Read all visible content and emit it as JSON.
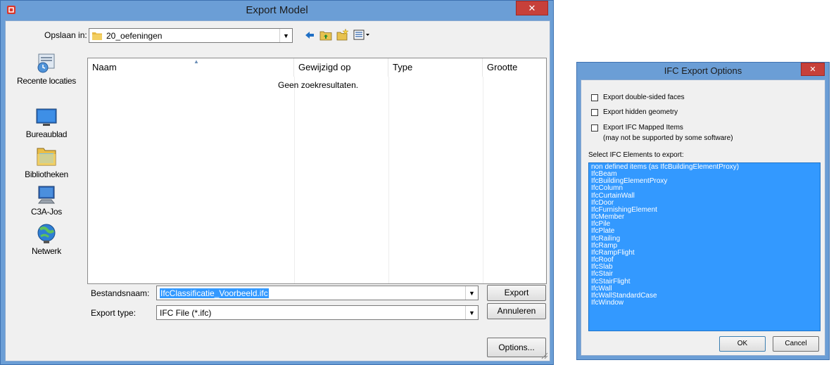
{
  "export_dialog": {
    "title": "Export Model",
    "save_in_label": "Opslaan in:",
    "save_in_value": "20_oefeningen",
    "places": [
      {
        "label": "Recente locaties",
        "icon": "recent-places-icon"
      },
      {
        "label": "Bureaublad",
        "icon": "desktop-icon"
      },
      {
        "label": "Bibliotheken",
        "icon": "libraries-icon"
      },
      {
        "label": "C3A-Jos",
        "icon": "computer-icon"
      },
      {
        "label": "Netwerk",
        "icon": "network-icon"
      }
    ],
    "columns": [
      "Naam",
      "Gewijzigd op",
      "Type",
      "Grootte"
    ],
    "empty_text": "Geen zoekresultaten.",
    "filename_label": "Bestandsnaam:",
    "filename_value": "IfcClassificatie_Voorbeeld.ifc",
    "export_type_label": "Export type:",
    "export_type_value": "IFC File (*.ifc)",
    "export_button": "Export",
    "cancel_button": "Annuleren",
    "options_button": "Options..."
  },
  "ifc_dialog": {
    "title": "IFC Export Options",
    "checkbox_double_sided": "Export double-sided faces",
    "checkbox_hidden": "Export hidden geometry",
    "checkbox_mapped": "Export IFC Mapped Items",
    "checkbox_mapped_note": "(may not be supported by some software)",
    "elements_label": "Select IFC Elements to export:",
    "elements": [
      "non defined items (as IfcBuildingElementProxy)",
      "IfcBeam",
      "IfcBuildingElementProxy",
      "IfcColumn",
      "IfcCurtainWall",
      "IfcDoor",
      "IfcFurnishingElement",
      "IfcMember",
      "IfcPile",
      "IfcPlate",
      "IfcRailing",
      "IfcRamp",
      "IfcRampFlight",
      "IfcRoof",
      "IfcSlab",
      "IfcStair",
      "IfcStairFlight",
      "IfcWall",
      "IfcWallStandardCase",
      "IfcWindow"
    ],
    "ok_button": "OK",
    "cancel_button": "Cancel"
  },
  "colors": {
    "title_bar": "#6b9ed6",
    "close_button": "#c7403a",
    "selection": "#3399ff"
  }
}
